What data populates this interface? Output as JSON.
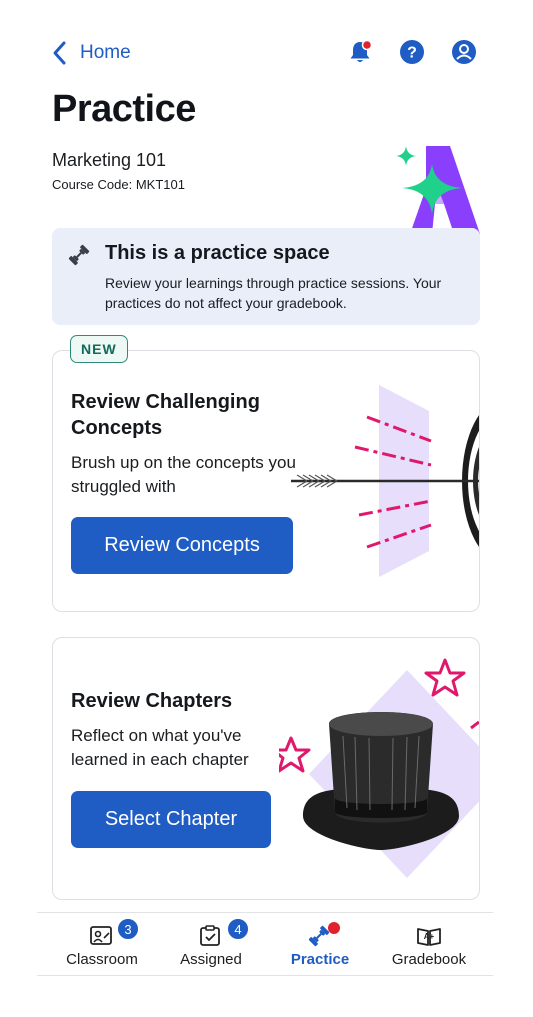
{
  "header": {
    "back_label": "Home",
    "icons": [
      "notification-bell-icon",
      "help-icon",
      "profile-icon"
    ],
    "notification_dot": true
  },
  "page": {
    "title": "Practice",
    "course_name": "Marketing 101",
    "course_code": "Course Code: MKT101"
  },
  "notice": {
    "icon": "dumbbell-icon",
    "title": "This is a practice space",
    "text": "Review your learnings through practice sessions. Your practices do not affect your gradebook."
  },
  "cards": [
    {
      "badge": "NEW",
      "title": "Review Challenging Concepts",
      "description": "Brush up on the concepts you struggled with",
      "button": "Review Concepts",
      "illustration": "arrow-target-illustration"
    },
    {
      "title": "Review Chapters",
      "description": "Reflect on what you've learned in each chapter",
      "button": "Select Chapter",
      "illustration": "top-hat-stars-illustration"
    }
  ],
  "tabs": [
    {
      "label": "Classroom",
      "icon": "classroom-icon",
      "count": "3",
      "active": false
    },
    {
      "label": "Assigned",
      "icon": "assigned-icon",
      "count": "4",
      "active": false
    },
    {
      "label": "Practice",
      "icon": "practice-icon",
      "active": true,
      "dot": true
    },
    {
      "label": "Gradebook",
      "icon": "gradebook-icon",
      "active": false
    }
  ],
  "colors": {
    "accent": "#1f5cc4",
    "notice_bg": "#e9eef9",
    "badge_border": "#2e8b7a",
    "notification_dot": "#e0212e",
    "logo_purple": "#8a3ffc",
    "logo_green": "#1fd18b",
    "art_pink": "#e0186c",
    "art_lavender": "#e6defa"
  }
}
